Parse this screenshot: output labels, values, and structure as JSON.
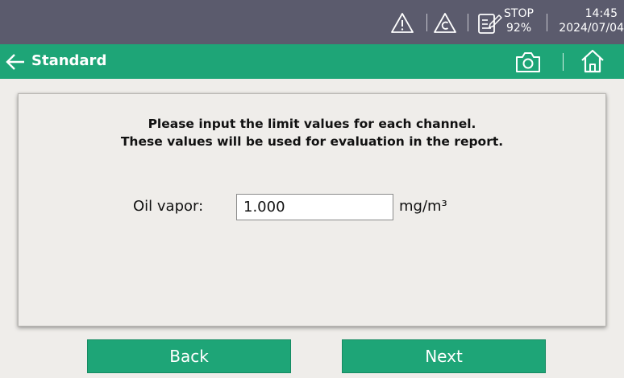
{
  "status_bar": {
    "icons": [
      "warning-icon",
      "calibration-warning-icon",
      "recorder-icon"
    ],
    "recorder_state": "STOP",
    "recorder_percent": "92%",
    "time": "14:45",
    "date": "2024/07/04"
  },
  "nav": {
    "title": "Standard",
    "icons": [
      "back-arrow-icon",
      "camera-icon",
      "home-icon"
    ]
  },
  "content": {
    "instruction_line1": "Please input the limit values for each channel.",
    "instruction_line2": "These values will be used for evaluation in the report.",
    "field": {
      "label": "Oil vapor:",
      "value": "1.000",
      "unit": "mg/m³"
    }
  },
  "buttons": {
    "back": "Back",
    "next": "Next"
  },
  "colors": {
    "status_bar_bg": "#5b5b6d",
    "accent_green": "#1ea577",
    "background": "#efedea"
  }
}
